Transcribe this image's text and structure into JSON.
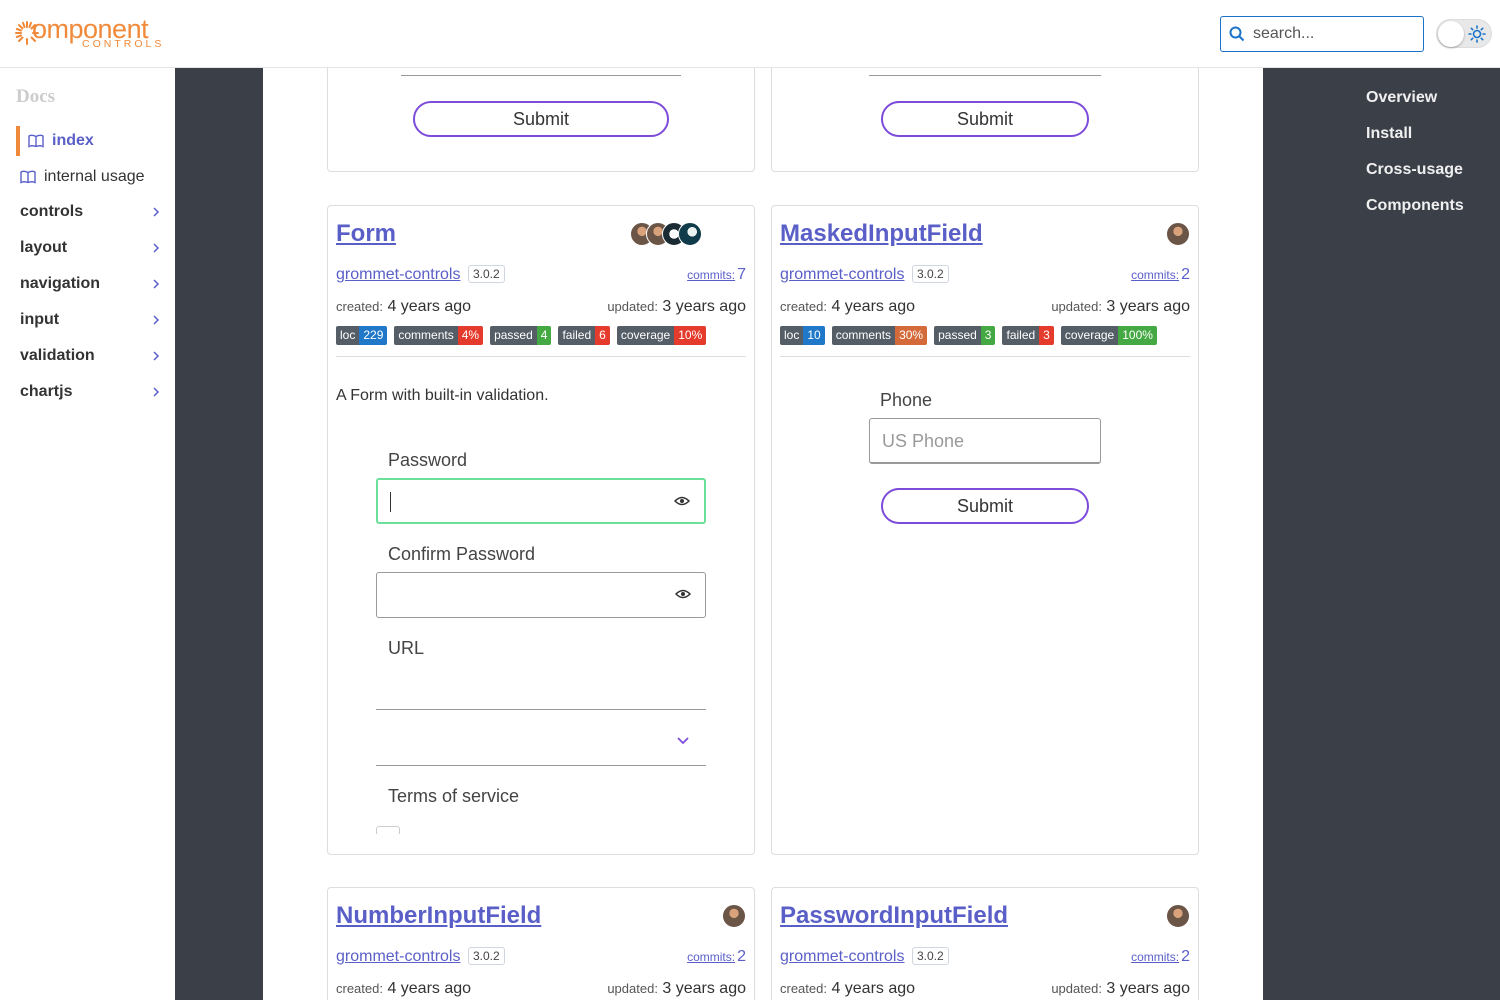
{
  "header": {
    "logo_main": "omponent",
    "logo_sub": "CONTROLS",
    "search_placeholder": "search..."
  },
  "sidebar": {
    "title": "Docs",
    "docs": [
      {
        "label": "index"
      },
      {
        "label": "internal usage"
      }
    ],
    "groups": [
      {
        "label": "controls"
      },
      {
        "label": "layout"
      },
      {
        "label": "navigation"
      },
      {
        "label": "input"
      },
      {
        "label": "validation"
      },
      {
        "label": "chartjs"
      }
    ]
  },
  "toc": [
    "Overview",
    "Install",
    "Cross-usage",
    "Components"
  ],
  "top_cards": {
    "submit_label": "Submit"
  },
  "cards": [
    {
      "title": "Form",
      "repo": "grommet-controls",
      "version": "3.0.2",
      "commits_label": "commits:",
      "commits": "7",
      "created_label": "created:",
      "created": "4 years ago",
      "updated_label": "updated:",
      "updated": "3 years ago",
      "badges": [
        {
          "key": "loc",
          "value": "229",
          "color": "#1f78c8"
        },
        {
          "key": "comments",
          "value": "4%",
          "color": "#e53b2c"
        },
        {
          "key": "passed",
          "value": "4",
          "color": "#44a843"
        },
        {
          "key": "failed",
          "value": "6",
          "color": "#e53b2c"
        },
        {
          "key": "coverage",
          "value": "10%",
          "color": "#e53b2c"
        }
      ],
      "description": "A Form with built-in validation.",
      "fields": {
        "password": "Password",
        "confirm_password": "Confirm Password",
        "url": "URL",
        "terms": "Terms of service"
      }
    },
    {
      "title": "MaskedInputField",
      "repo": "grommet-controls",
      "version": "3.0.2",
      "commits_label": "commits:",
      "commits": "2",
      "created_label": "created:",
      "created": "4 years ago",
      "updated_label": "updated:",
      "updated": "3 years ago",
      "badges": [
        {
          "key": "loc",
          "value": "10",
          "color": "#1f78c8"
        },
        {
          "key": "comments",
          "value": "30%",
          "color": "#d4693a"
        },
        {
          "key": "passed",
          "value": "3",
          "color": "#44a843"
        },
        {
          "key": "failed",
          "value": "3",
          "color": "#e53b2c"
        },
        {
          "key": "coverage",
          "value": "100%",
          "color": "#44a843"
        }
      ],
      "phone_label": "Phone",
      "phone_placeholder": "US Phone",
      "submit_label": "Submit"
    },
    {
      "title": "NumberInputField",
      "repo": "grommet-controls",
      "version": "3.0.2",
      "commits_label": "commits:",
      "commits": "2",
      "created_label": "created:",
      "created": "4 years ago",
      "updated_label": "updated:",
      "updated": "3 years ago"
    },
    {
      "title": "PasswordInputField",
      "repo": "grommet-controls",
      "version": "3.0.2",
      "commits_label": "commits:",
      "commits": "2",
      "created_label": "created:",
      "created": "4 years ago",
      "updated_label": "updated:",
      "updated": "3 years ago"
    }
  ],
  "colors": {
    "accent": "#5a5fc8",
    "brand": "#f08a3a",
    "button_border": "#7d4cdb",
    "dark_gutter": "#3a3f48",
    "focus_border": "#6be09a"
  }
}
